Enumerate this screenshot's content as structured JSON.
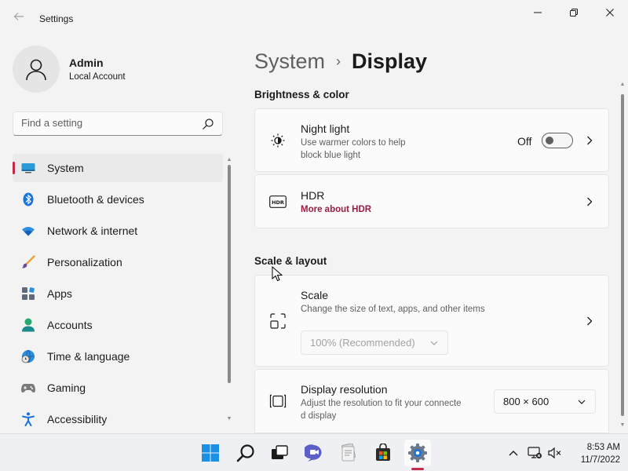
{
  "window": {
    "title": "Settings"
  },
  "profile": {
    "name": "Admin",
    "account_type": "Local Account"
  },
  "search": {
    "placeholder": "Find a setting"
  },
  "sidebar": {
    "items": [
      {
        "label": "System",
        "icon": "system-icon",
        "active": true
      },
      {
        "label": "Bluetooth & devices",
        "icon": "bluetooth-icon"
      },
      {
        "label": "Network & internet",
        "icon": "wifi-icon"
      },
      {
        "label": "Personalization",
        "icon": "brush-icon"
      },
      {
        "label": "Apps",
        "icon": "apps-icon"
      },
      {
        "label": "Accounts",
        "icon": "accounts-icon"
      },
      {
        "label": "Time & language",
        "icon": "globe-clock-icon"
      },
      {
        "label": "Gaming",
        "icon": "gamepad-icon"
      },
      {
        "label": "Accessibility",
        "icon": "accessibility-icon"
      }
    ]
  },
  "breadcrumb": {
    "parent": "System",
    "separator": "›",
    "current": "Display"
  },
  "brightness_section": {
    "title": "Brightness & color",
    "night_light": {
      "title": "Night light",
      "description_line1": "Use warmer colors to help",
      "description_line2": "block blue light",
      "state_label": "Off",
      "enabled": false
    },
    "hdr": {
      "title": "HDR",
      "link": "More about HDR"
    }
  },
  "scale_section": {
    "title": "Scale & layout",
    "scale": {
      "title": "Scale",
      "description": "Change the size of text, apps, and other items",
      "value": "100% (Recommended)",
      "disabled": true
    },
    "resolution": {
      "title": "Display resolution",
      "description_line1": "Adjust the resolution to fit your connecte",
      "description_line2": "d display",
      "value": "800 × 600"
    }
  },
  "taskbar": {
    "apps": [
      "start-icon",
      "search-icon",
      "task-view-icon",
      "chat-icon",
      "file-explorer-icon",
      "store-icon",
      "settings-icon"
    ],
    "active_app": "settings-icon",
    "clock": {
      "time": "8:53 AM",
      "date": "11/7/2022"
    }
  },
  "colors": {
    "accent": "#c42b4a",
    "link": "#9c1d3f"
  }
}
